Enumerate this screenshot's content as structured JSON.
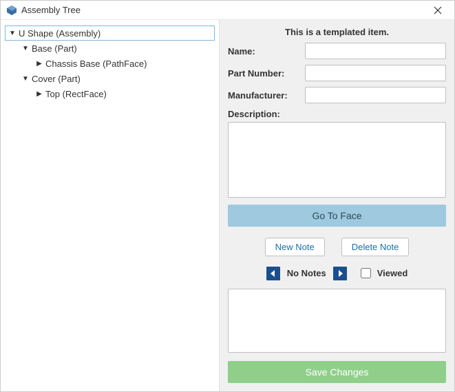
{
  "window": {
    "title": "Assembly Tree"
  },
  "tree": {
    "items": [
      {
        "label": "U Shape (Assembly)",
        "indent": 0,
        "expanded": true,
        "selected": true
      },
      {
        "label": "Base (Part)",
        "indent": 1,
        "expanded": true,
        "selected": false
      },
      {
        "label": "Chassis Base (PathFace)",
        "indent": 2,
        "expanded": false,
        "selected": false
      },
      {
        "label": "Cover (Part)",
        "indent": 1,
        "expanded": true,
        "selected": false
      },
      {
        "label": "Top (RectFace)",
        "indent": 2,
        "expanded": false,
        "selected": false
      }
    ]
  },
  "form": {
    "templated_msg": "This is a templated item.",
    "name_label": "Name:",
    "name_value": "",
    "partno_label": "Part Number:",
    "partno_value": "",
    "manufacturer_label": "Manufacturer:",
    "manufacturer_value": "",
    "description_label": "Description:",
    "description_value": "",
    "goto_face_label": "Go To Face",
    "new_note_label": "New Note",
    "delete_note_label": "Delete Note",
    "notes_status": "No Notes",
    "viewed_label": "Viewed",
    "viewed_checked": false,
    "notes_value": "",
    "save_label": "Save Changes"
  }
}
